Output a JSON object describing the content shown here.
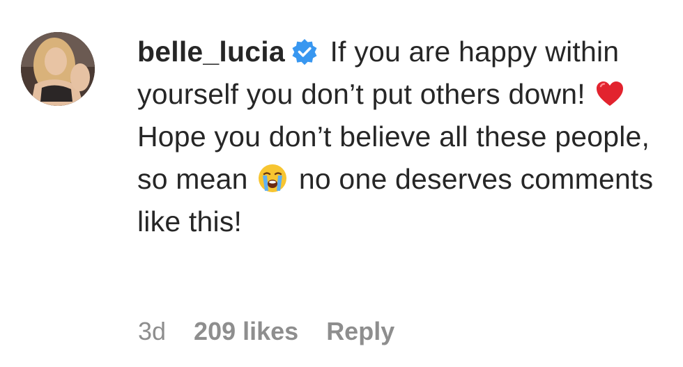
{
  "comment": {
    "username": "belle_lucia",
    "verified_icon": "verified-badge-icon",
    "text_part1": " If you are happy within yourself you don’t put others down! ",
    "emoji1": "red-heart-emoji",
    "text_part2": " Hope you don’t believe all these people, so mean ",
    "emoji2": "loudly-crying-face-emoji",
    "text_part3": " no one deserves comments like this!",
    "time": "3d",
    "likes": "209 likes",
    "reply_label": "Reply"
  },
  "colors": {
    "text": "#262626",
    "meta": "#8e8e8e",
    "verified": "#3897f0"
  }
}
